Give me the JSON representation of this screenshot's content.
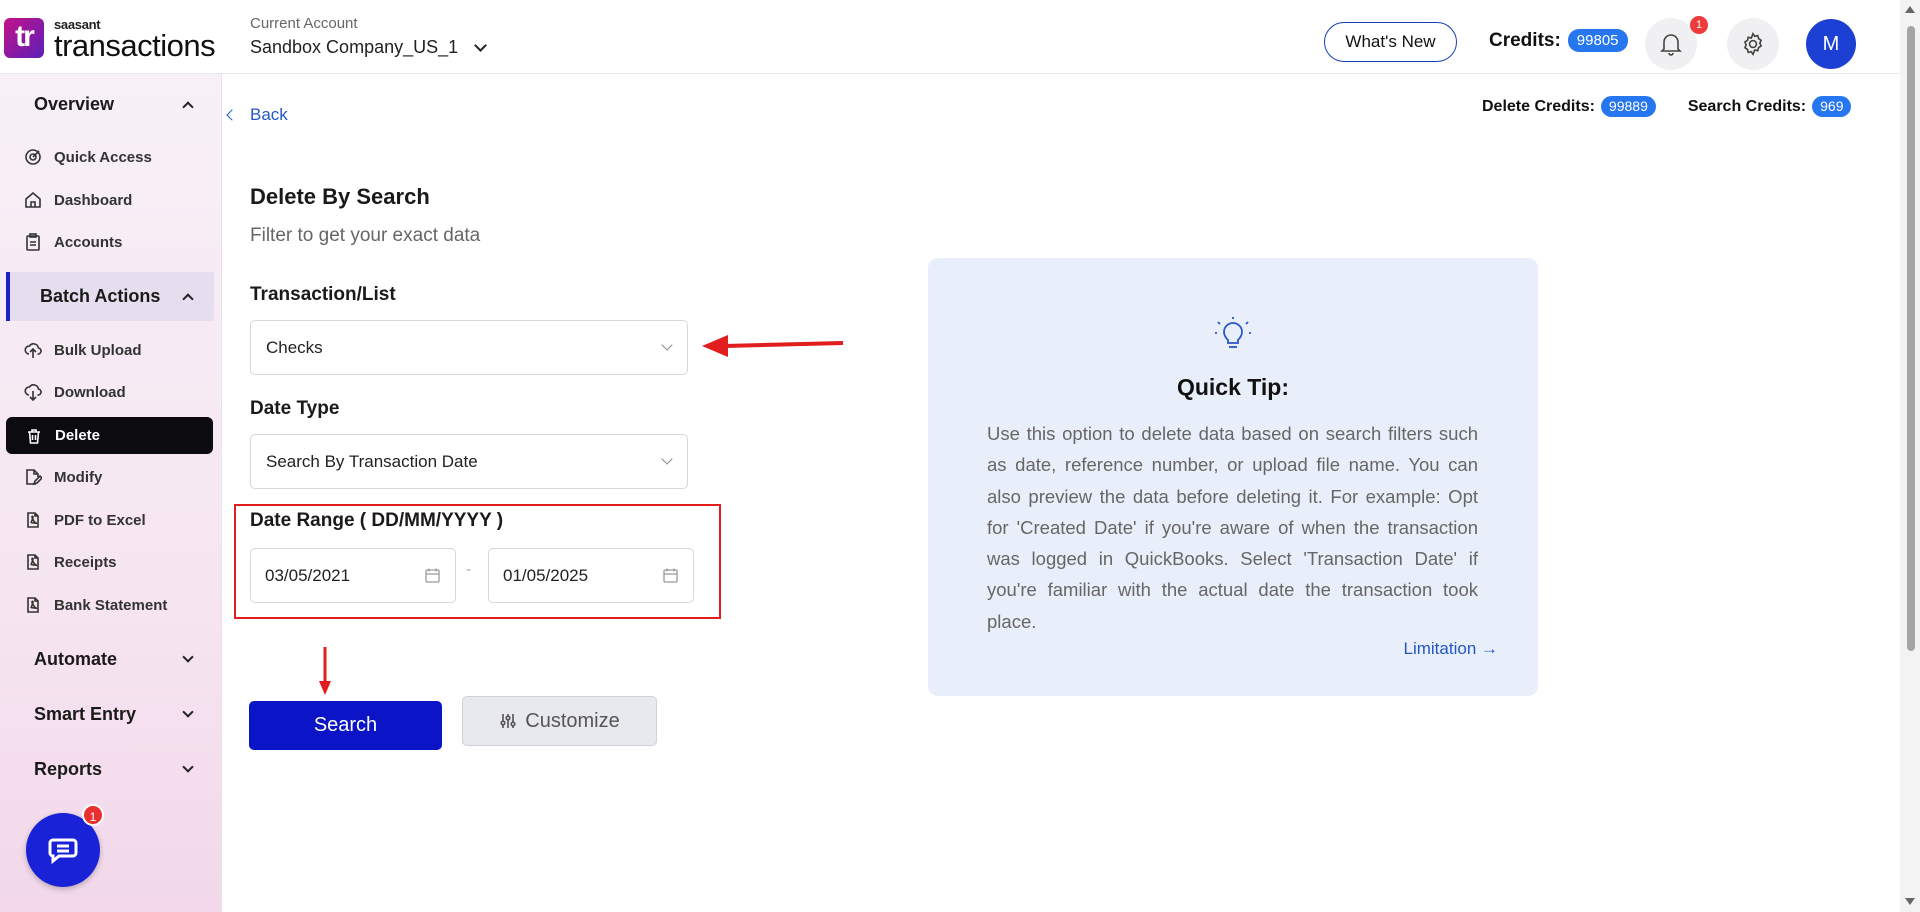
{
  "header": {
    "logo_mark": "tr",
    "logo_small": "saasant",
    "logo_big": "transactions",
    "account_label": "Current Account",
    "account_name": "Sandbox Company_US_1",
    "whats_new": "What's New",
    "credits_label": "Credits:",
    "credits_value": "99805",
    "notifications_count": "1",
    "avatar_initial": "M"
  },
  "sidebar": {
    "overview": "Overview",
    "overview_items": [
      "Quick Access",
      "Dashboard",
      "Accounts"
    ],
    "batch_actions": "Batch Actions",
    "batch_items": [
      "Bulk Upload",
      "Download",
      "Delete",
      "Modify",
      "PDF to Excel",
      "Receipts",
      "Bank Statement"
    ],
    "active_item": "Delete",
    "automate": "Automate",
    "smart_entry": "Smart Entry",
    "reports": "Reports",
    "chat_badge": "1"
  },
  "main": {
    "back": "Back",
    "delete_credits_label": "Delete Credits:",
    "delete_credits_value": "99889",
    "search_credits_label": "Search Credits:",
    "search_credits_value": "969",
    "title": "Delete By Search",
    "subtitle": "Filter to get your exact data",
    "transaction_label": "Transaction/List",
    "transaction_value": "Checks",
    "date_type_label": "Date Type",
    "date_type_value": "Search By Transaction Date",
    "date_range_label": "Date Range ( DD/MM/YYYY )",
    "date_from": "03/05/2021",
    "date_separator": "-",
    "date_to": "01/05/2025",
    "search_button": "Search",
    "customize_button": "Customize"
  },
  "tip": {
    "title": "Quick Tip:",
    "body": "Use this option to delete data based on search filters such as date, reference number, or upload file name. You can also preview the data before deleting it. For example: Opt for 'Created Date' if you're aware of when the transaction was logged in QuickBooks. Select 'Transaction Date' if you're familiar with the actual date the transaction took place.",
    "link": "Limitation →"
  },
  "colors": {
    "primary": "#0b14c6",
    "badge": "#2676f0",
    "annotation_red": "#e11d1d",
    "tip_bg": "#e9effa"
  }
}
